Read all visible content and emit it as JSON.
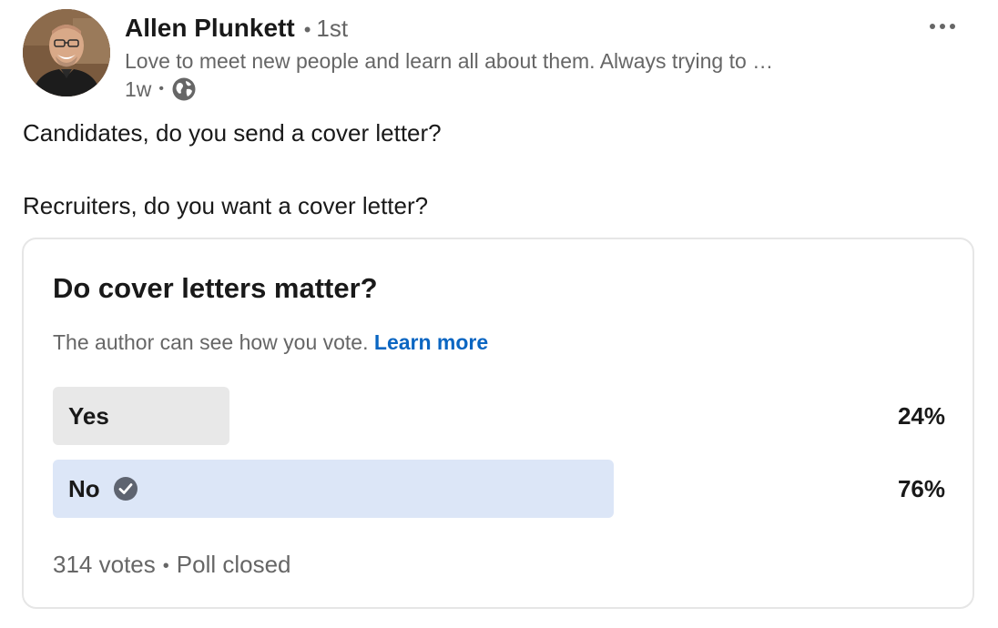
{
  "post": {
    "author": {
      "name": "Allen Plunkett",
      "degree": "1st",
      "headline": "Love to meet new people and learn all about them. Always trying to …",
      "time_ago": "1w",
      "visibility_icon": "globe-icon",
      "avatar_icon": "profile-photo"
    },
    "more_icon": "ellipsis-icon",
    "text_lines": [
      "Candidates, do you send a cover letter?",
      "Recruiters, do you want a cover letter?"
    ]
  },
  "poll": {
    "question": "Do cover letters matter?",
    "privacy_text": "The author can see how you vote.",
    "learn_more_label": "Learn more",
    "options": [
      {
        "label": "Yes",
        "percent_label": "24%",
        "percent": 24,
        "selected": false,
        "fill_color": "#e8e8e8"
      },
      {
        "label": "No",
        "percent_label": "76%",
        "percent": 76,
        "selected": true,
        "fill_color": "#dce6f7",
        "check_icon": "check-circle-icon"
      }
    ],
    "votes_label": "314 votes",
    "status_label": "Poll closed"
  },
  "colors": {
    "link": "#0a66c2",
    "secondary_text": "#666666",
    "primary_text": "#191919",
    "check_icon": "#5e6470"
  }
}
